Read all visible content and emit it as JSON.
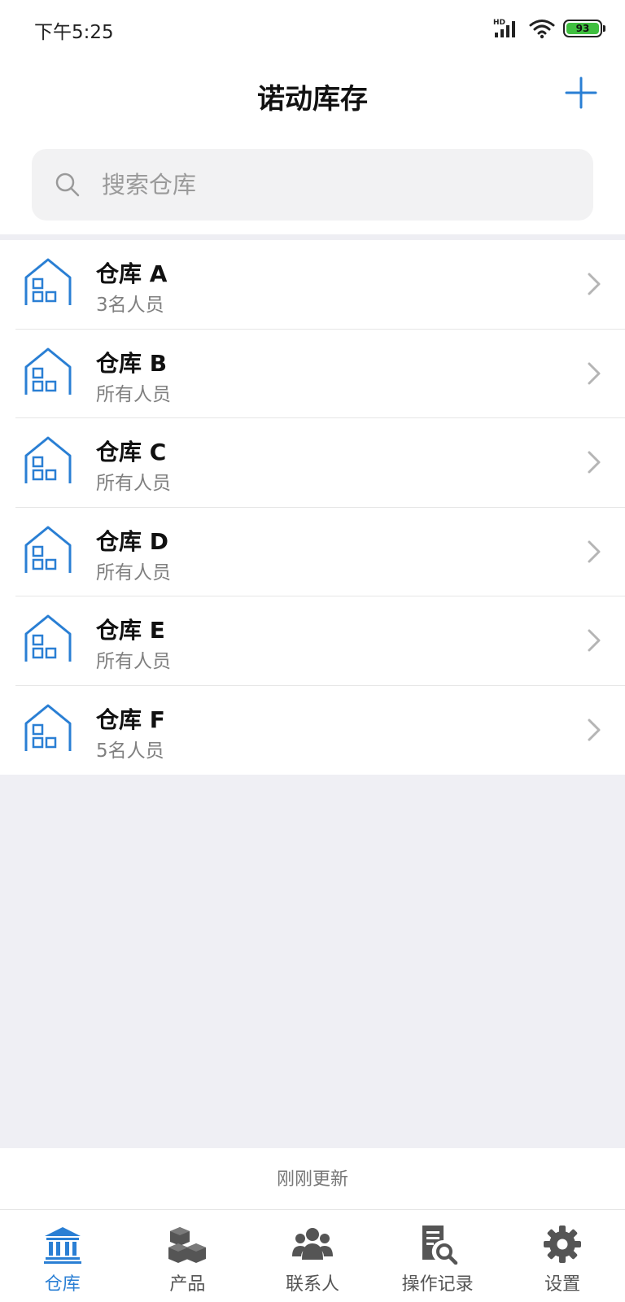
{
  "status_bar": {
    "time": "下午5:25",
    "battery": "93"
  },
  "header": {
    "title": "诺动库存"
  },
  "search": {
    "placeholder": "搜索仓库"
  },
  "warehouses": [
    {
      "name": "仓库 A",
      "members": "3名人员"
    },
    {
      "name": "仓库 B",
      "members": "所有人员"
    },
    {
      "name": "仓库 C",
      "members": "所有人员"
    },
    {
      "name": "仓库 D",
      "members": "所有人员"
    },
    {
      "name": "仓库 E",
      "members": "所有人员"
    },
    {
      "name": "仓库 F",
      "members": "5名人员"
    }
  ],
  "update_status": "刚刚更新",
  "tabs": [
    {
      "label": "仓库",
      "icon": "bank-icon",
      "active": true
    },
    {
      "label": "产品",
      "icon": "boxes-icon",
      "active": false
    },
    {
      "label": "联系人",
      "icon": "people-icon",
      "active": false
    },
    {
      "label": "操作记录",
      "icon": "document-search-icon",
      "active": false
    },
    {
      "label": "设置",
      "icon": "gear-icon",
      "active": false
    }
  ],
  "colors": {
    "accent": "#2a7fd4",
    "battery": "#3fbf3f",
    "background_gray": "#efeff4"
  }
}
